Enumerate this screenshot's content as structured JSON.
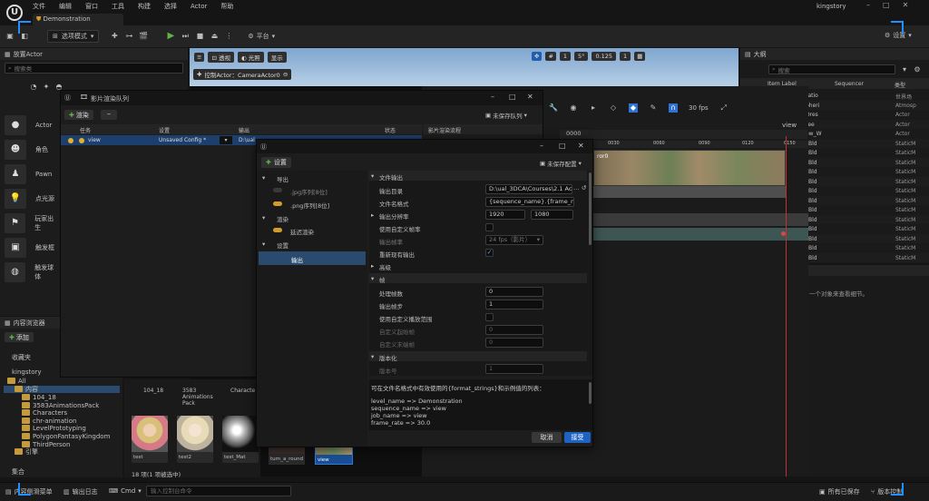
{
  "menu": {
    "items": [
      "文件",
      "编辑",
      "窗口",
      "工具",
      "构建",
      "选择",
      "Actor",
      "帮助"
    ],
    "project": "kingstory",
    "level_tab": "Demonstration"
  },
  "toolbar": {
    "select_mode": "选项模式",
    "platform": "平台",
    "settings": "设置"
  },
  "place_actors": {
    "title": "放置Actor",
    "search_placeholder": "搜索类",
    "items": [
      "Actor",
      "角色",
      "Pawn",
      "点光源",
      "玩家出生",
      "触发框",
      "触发球体"
    ]
  },
  "viewport": {
    "perspective": "透视",
    "lit": "光照",
    "show": "显示",
    "pilot": "控制Actor：CameraActor0",
    "grid_snap": "1",
    "rot_snap": "5°",
    "scale_snap": "0.125",
    "cam_speed": "1"
  },
  "queue": {
    "title": "影片渲染队列",
    "render_label": "渲染",
    "unsaved_label": "未保存队列",
    "columns": [
      "任务",
      "设置",
      "输出",
      "状态"
    ],
    "job": {
      "name": "view",
      "config": "Unsaved Config *",
      "output": "D:\\ual"
    },
    "right_header": "影片渲染流程"
  },
  "config": {
    "add_setting": "设置",
    "unsaved_config": "未保存配置",
    "tree": {
      "export": "导出",
      "jpg": ".jpg序列[8位]",
      "png": ".png序列[8位]",
      "render": "渲染",
      "deferred": "延迟渲染",
      "settings": "设置",
      "output": "输出"
    },
    "sections": {
      "file_output": "文件输出",
      "advanced": "高级",
      "frames": "帧",
      "versioning": "版本化"
    },
    "fields": {
      "output_dir_label": "输出目录",
      "output_dir": "D:\\ual_3DCA\\Courses\\2.1 Act",
      "filename_label": "文件名格式",
      "filename": "{sequence_name}.{frame_number}",
      "resolution_label": "输出分辨率",
      "res_x": "1920",
      "res_y": "1080",
      "custom_fps_label": "使用自定义帧率",
      "fps_label": "输出帧率",
      "fps_value": "24 fps（影片）",
      "overwrite_label": "重新现有输出",
      "handle_frames_label": "处理帧数",
      "handle_frames": "0",
      "output_step_label": "输出帧步",
      "output_step": "1",
      "custom_range_label": "使用自定义播放范围",
      "start_frame_label": "自定义起始帧",
      "start_frame": "0",
      "end_frame_label": "自定义末端帧",
      "end_frame": "0",
      "version_label": "版本号",
      "version": "1"
    },
    "help_title": "可在文件名格式中有效使用的{format_strings}和示例值的列表：",
    "help_lines": [
      "level_name => Demonstration",
      "sequence_name => view",
      "job_name => view",
      "frame_rate => 30.0"
    ],
    "cancel": "取消",
    "accept": "接受"
  },
  "sequencer": {
    "fps": "30 fps",
    "timecode": "0000",
    "ticks": [
      "0030",
      "0060",
      "0090",
      "0120",
      "0150"
    ],
    "track": "view",
    "shot_label": "ror0"
  },
  "outliner": {
    "title": "大纲",
    "search_placeholder": "搜索",
    "col_label": "Item Label",
    "col_sequencer": "Sequencer",
    "col_type": "类型",
    "rows": [
      {
        "name": "ratio",
        "type": "世界场"
      },
      {
        "name": "pheri",
        "type": "Atmosp"
      },
      {
        "name": "Dres",
        "type": "Actor"
      },
      {
        "name": "ree",
        "type": "Actor"
      },
      {
        "name": "ow_W",
        "type": "Actor"
      },
      {
        "name": "_Bld",
        "type": "StaticM"
      },
      {
        "name": "_Bld",
        "type": "StaticM"
      },
      {
        "name": "_Bld",
        "type": "StaticM"
      },
      {
        "name": "_Bld",
        "type": "StaticM"
      },
      {
        "name": "_Bld",
        "type": "StaticM"
      },
      {
        "name": "_Bld",
        "type": "StaticM"
      },
      {
        "name": "_Bld",
        "type": "StaticM"
      },
      {
        "name": "_Bld",
        "type": "StaticM"
      },
      {
        "name": "_Bld",
        "type": "StaticM"
      },
      {
        "name": "_Bld",
        "type": "StaticM"
      },
      {
        "name": "_Bld",
        "type": "StaticM"
      },
      {
        "name": "_Bld",
        "type": "StaticM"
      },
      {
        "name": "_Bld",
        "type": "StaticM"
      }
    ],
    "details_hint": "一个对象来查看细节。"
  },
  "content_browser": {
    "title": "内容浏览器",
    "add": "添加",
    "favorites": "收藏夹",
    "project": "kingstory",
    "all": "All",
    "content": "内容",
    "folders": [
      "104_18",
      "3583AnimationsPack",
      "Characters",
      "chr-animation",
      "LevelPrototyping",
      "PolygonFantasyKingdom",
      "ThirdPerson"
    ],
    "engine": "引擎",
    "collections": "集合",
    "grid_headers": [
      "104_18",
      "3583 Animations Pack",
      "Characte"
    ],
    "assets": [
      "test",
      "test2",
      "test_Mat",
      "turn_a_round",
      "view"
    ],
    "status": "18 项(1 项被选中)"
  },
  "statusbar": {
    "drawer": "内容侧滑菜单",
    "log": "输出日志",
    "cmd": "Cmd",
    "cmd_placeholder": "输入控制台命令",
    "saved": "所有已保存",
    "source_control": "版本控制"
  }
}
